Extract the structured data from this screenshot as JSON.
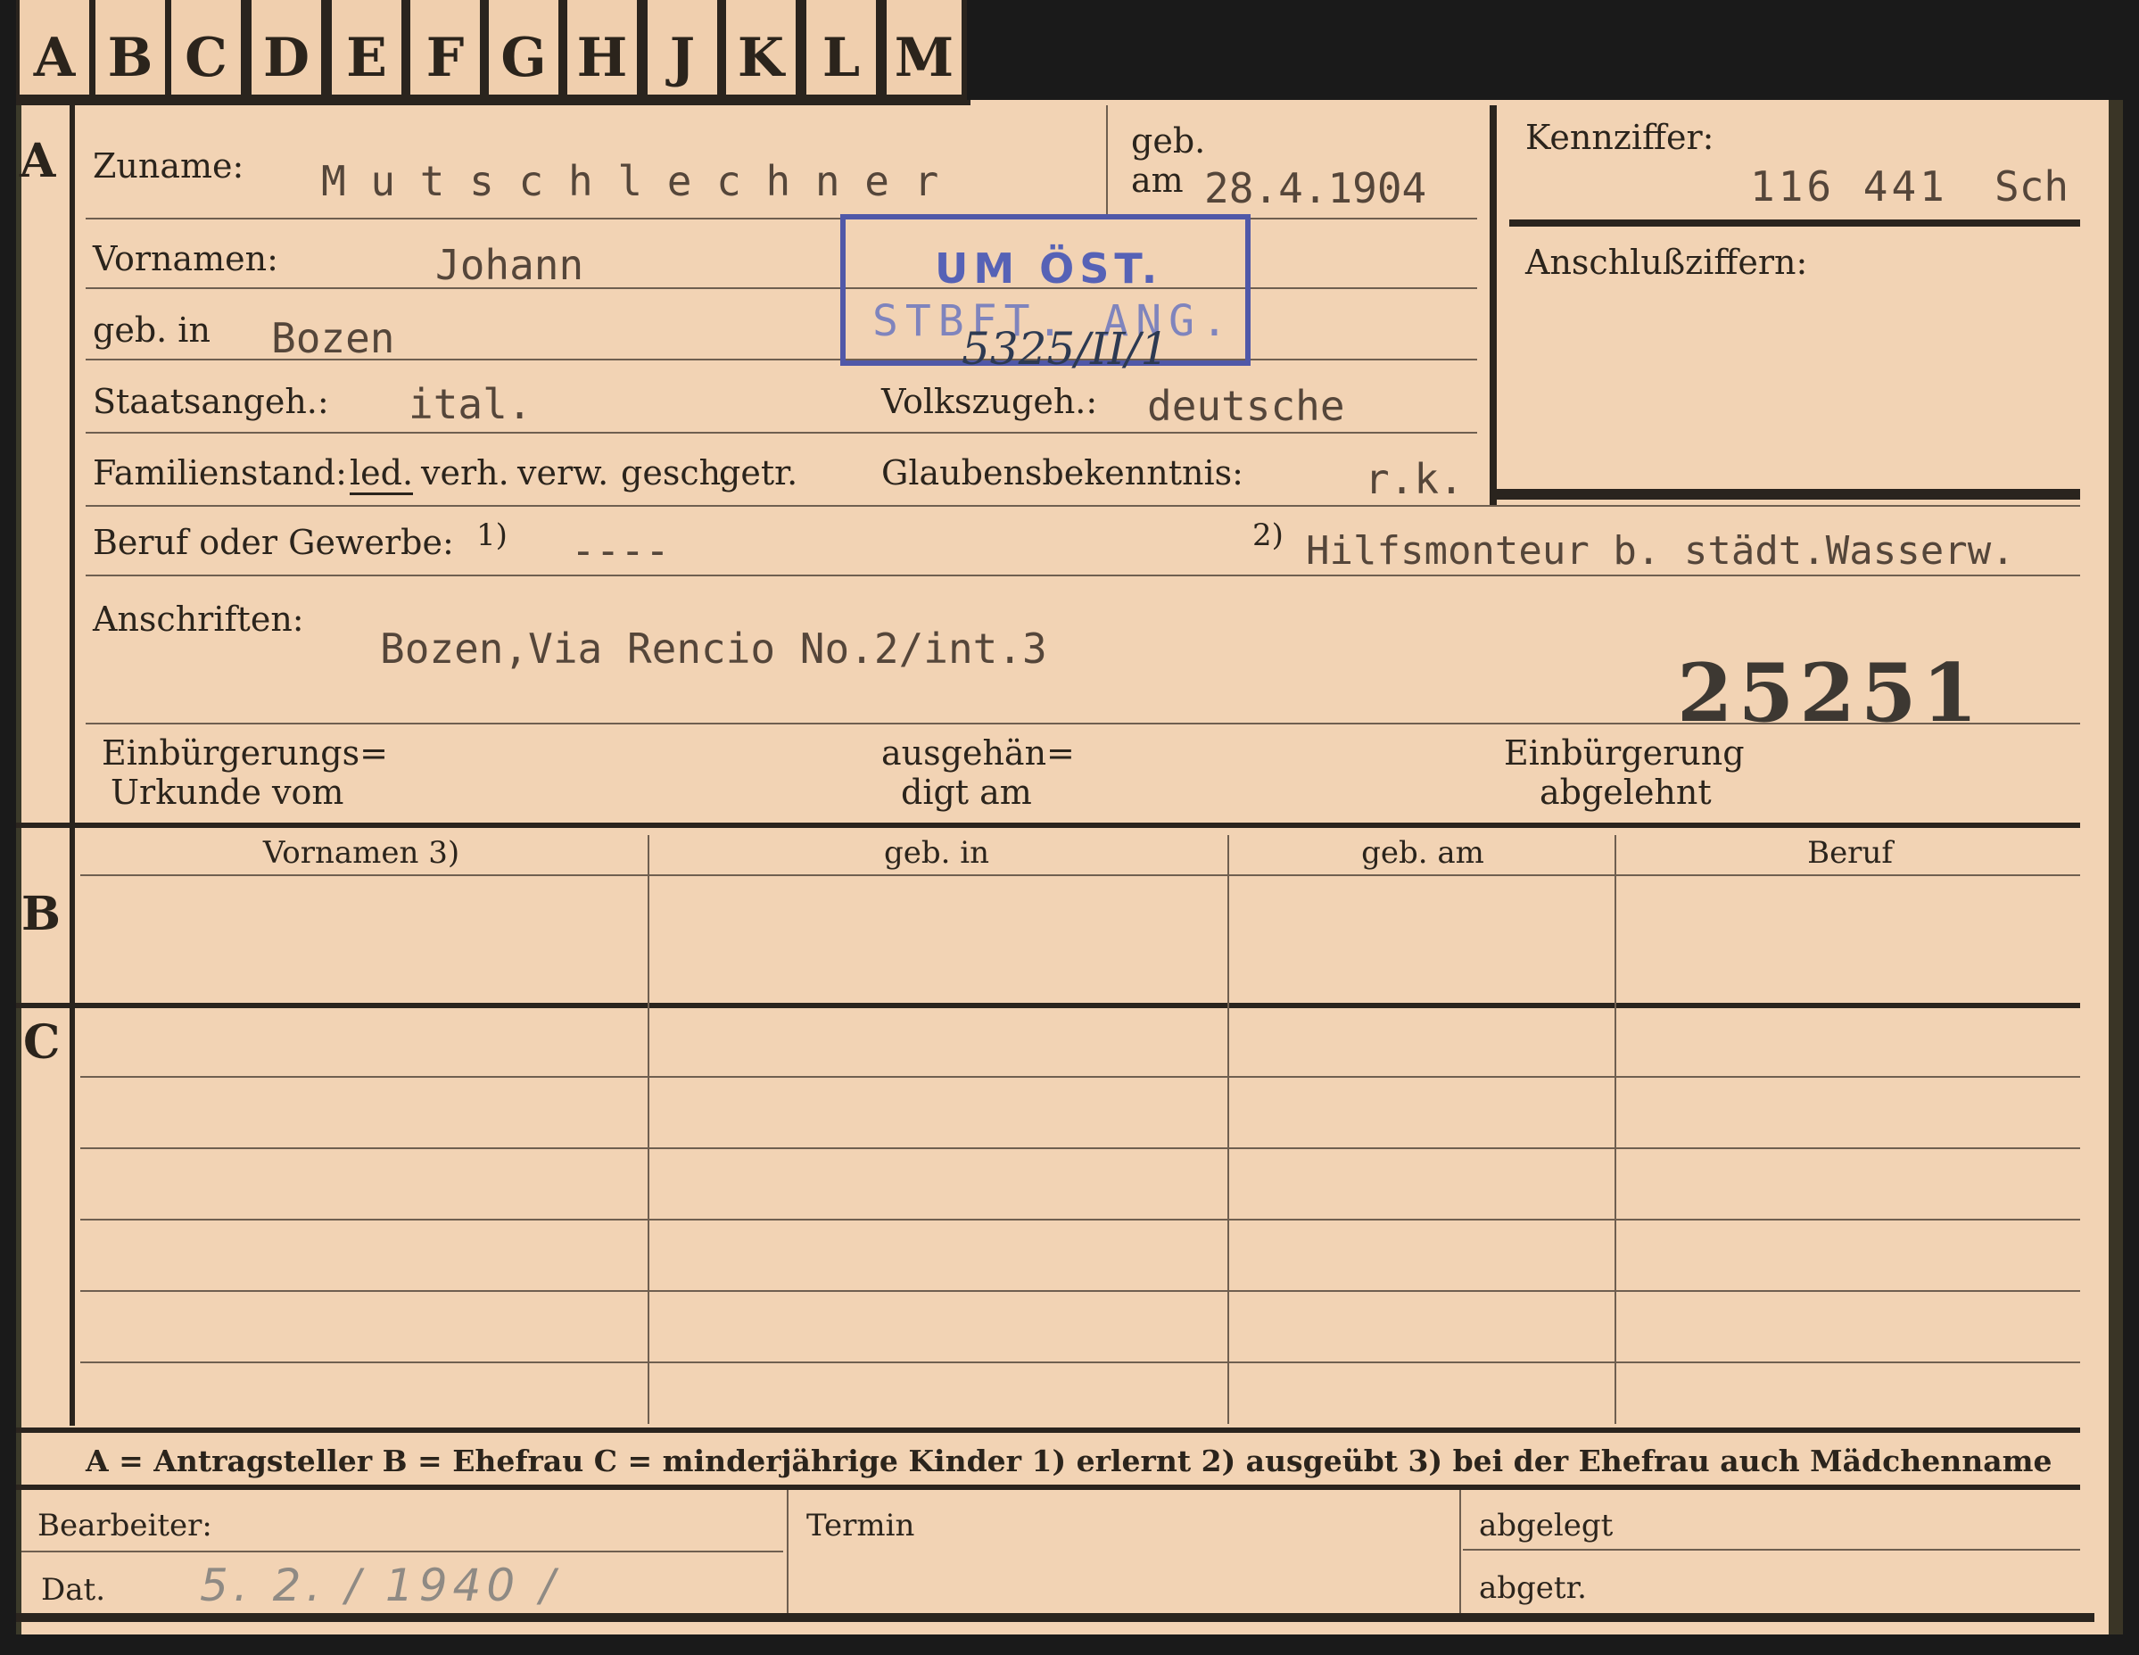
{
  "tabs": [
    "A",
    "B",
    "C",
    "D",
    "E",
    "F",
    "G",
    "H",
    "J",
    "K",
    "L",
    "M"
  ],
  "sections": {
    "a": "A",
    "b": "B",
    "c": "C"
  },
  "header": {
    "zuname_label": "Zuname:",
    "zuname_value": "M u t s c h l e c h n e r",
    "geb_label": "geb.",
    "am_label": "am",
    "geb_date": "28.4.1904",
    "kennziffer_label": "Kennziffer:",
    "kennziffer_value": "116 441",
    "kennziffer_suffix": "Sch",
    "anschluss_label": "Anschlußziffern:"
  },
  "fields": {
    "vornamen_label": "Vornamen:",
    "vornamen_value": "Johann",
    "gebin_label": "geb. in",
    "gebin_value": "Bozen",
    "staat_label": "Staatsangeh.:",
    "staat_value": "ital.",
    "volk_label": "Volkszugeh.:",
    "volk_value": "deutsche",
    "familien_label": "Familienstand:",
    "familien_options": [
      "led.",
      "verh.",
      "verw.",
      "gesch.",
      "getr."
    ],
    "glauben_label": "Glaubensbekenntnis:",
    "glauben_value": "r.k.",
    "beruf_label": "Beruf oder Gewerbe:",
    "beruf_sup1": "1)",
    "beruf_value1": "----",
    "beruf_sup2": "2)",
    "beruf_value2": "Hilfsmonteur b. städt.Wasserw.",
    "anschrift_label": "Anschriften:",
    "anschrift_value": "Bozen,Via Rencio No.2/int.3",
    "big_number": "25251",
    "einb_urkunde_1": "Einbürgerungs=",
    "einb_urkunde_2": "Urkunde vom",
    "ausgeh_1": "ausgehän=",
    "ausgeh_2": "digt am",
    "einb_abgelehnt_1": "Einbürgerung",
    "einb_abgelehnt_2": "abgelehnt"
  },
  "stamp": {
    "line1": "UM ÖST.",
    "line2": "STBFT. ANG.",
    "handwritten": "5325/II/1"
  },
  "table": {
    "headers": [
      "Vornamen 3)",
      "geb. in",
      "geb. am",
      "Beruf"
    ]
  },
  "legend": "A = Antragsteller   B = Ehefrau   C = minderjährige Kinder   1) erlernt   2) ausgeübt   3) bei der Ehefrau auch Mädchenname",
  "footer": {
    "bearbeiter_label": "Bearbeiter:",
    "termin_label": "Termin",
    "abgelegt_label": "abgelegt",
    "dat_label": "Dat.",
    "dat_value": "5. 2. / 1940 /",
    "abgetr_label": "abgetr."
  }
}
